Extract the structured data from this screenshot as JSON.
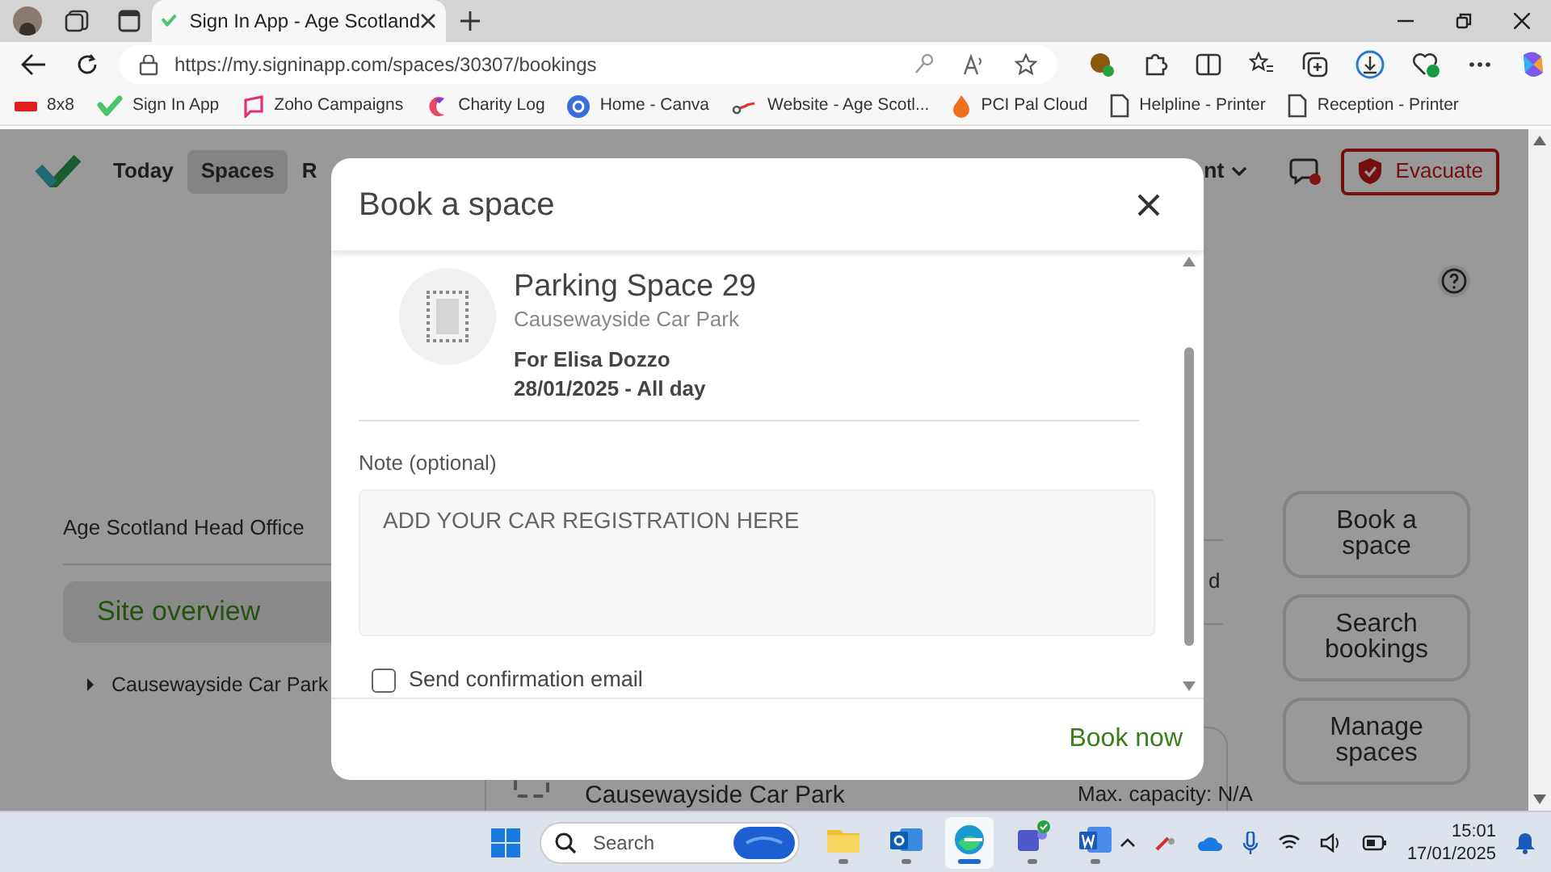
{
  "browser": {
    "tabs": [
      {
        "title": "Sign In App - Age Scotland",
        "selected": true
      }
    ],
    "url": "https://my.signinapp.com/spaces/30307/bookings",
    "bookmarks": [
      {
        "kind": "eightbyeight",
        "label": "8x8"
      },
      {
        "kind": "checkmark",
        "label": "Sign In App"
      },
      {
        "kind": "zoho",
        "label": "Zoho Campaigns"
      },
      {
        "kind": "charity",
        "label": "Charity Log"
      },
      {
        "kind": "canva",
        "label": "Home - Canva"
      },
      {
        "kind": "link",
        "label": "Website - Age Scotl..."
      },
      {
        "kind": "flame",
        "label": "PCI Pal Cloud"
      },
      {
        "kind": "document",
        "label": "Helpline - Printer"
      },
      {
        "kind": "document",
        "label": "Reception - Printer"
      }
    ]
  },
  "page": {
    "nav": [
      {
        "label": "Today",
        "selected": false
      },
      {
        "label": "Spaces",
        "selected": true
      },
      {
        "label": "R",
        "selected": false
      }
    ],
    "nav_menu": "nt",
    "evacuate": "Evacuate",
    "site": "Age Scotland Head Office",
    "sidebar": [
      {
        "label": "Site overview",
        "selected": true
      }
    ],
    "tree": [
      {
        "label": "Causewayside Car Park",
        "expanded": false
      }
    ],
    "fragment": "d",
    "card_title": "Causewayside Car Park",
    "capacity": "Max. capacity: N/A",
    "actions": [
      "Book a space",
      "Search bookings",
      "Manage spaces"
    ]
  },
  "modal": {
    "title": "Book a space",
    "space": "Parking Space 29",
    "location": "Causewayside Car Park",
    "for": "For Elisa Dozzo",
    "date": "28/01/2025 - All day",
    "note_label": "Note (optional)",
    "placeholder": "ADD YOUR CAR REGISTRATION HERE",
    "confirmation": {
      "label": "Send confirmation email",
      "checked": false
    },
    "button": "Book now"
  },
  "taskbar": {
    "search": "Search",
    "apps": [
      {
        "selected": false
      },
      {
        "selected": false
      },
      {
        "selected": true
      },
      {
        "selected": false
      },
      {
        "selected": false
      }
    ],
    "time": "15:01",
    "date": "17/01/2025"
  }
}
